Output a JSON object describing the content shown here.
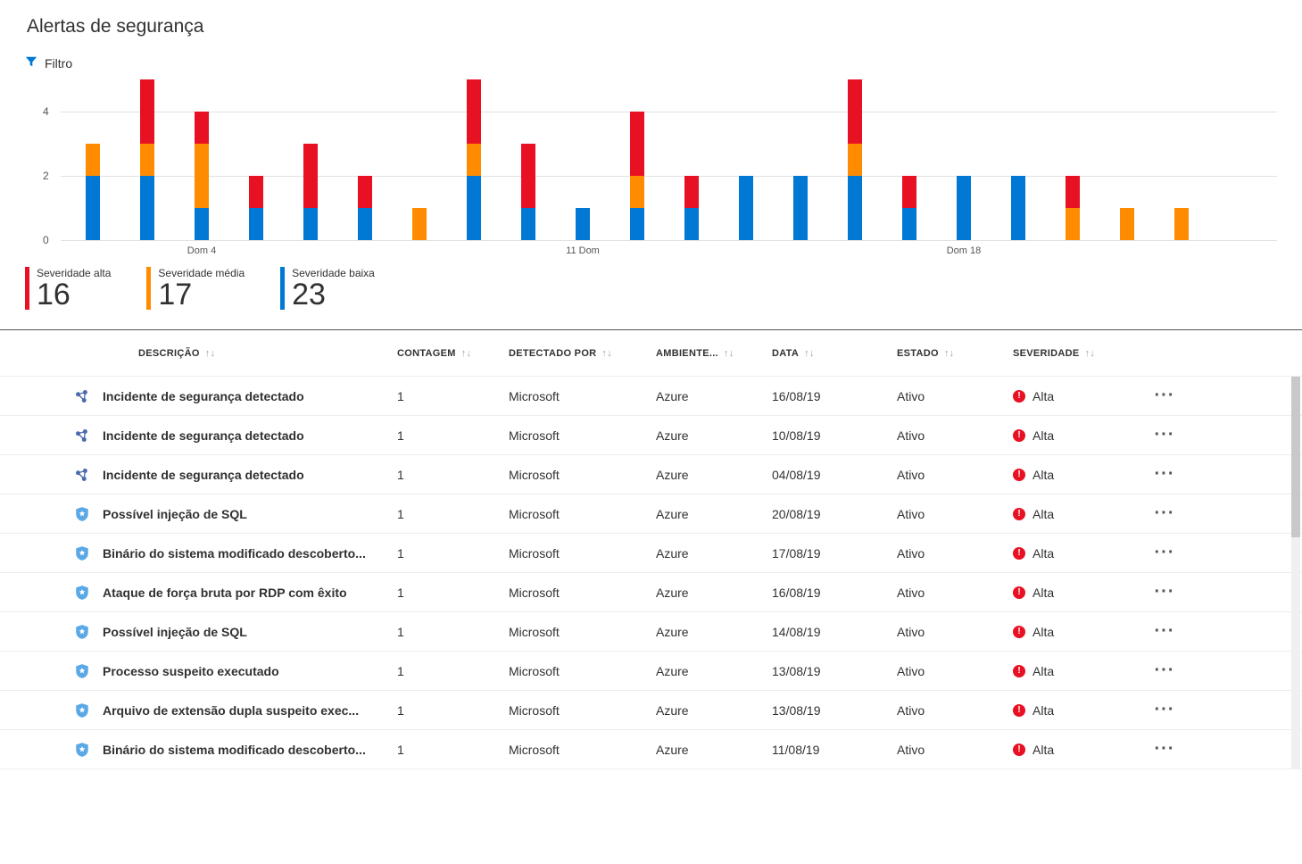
{
  "page_title": "Alertas de segurança",
  "filter_label": "Filtro",
  "chart_data": {
    "type": "bar",
    "stacked": true,
    "ylim": [
      0,
      5
    ],
    "yticks": [
      0,
      2,
      4
    ],
    "x_labels": [
      {
        "index": 2,
        "text": "Dom 4"
      },
      {
        "index": 9,
        "text": "11 Dom"
      },
      {
        "index": 16,
        "text": "Dom 18"
      }
    ],
    "series_names": [
      "Severidade baixa",
      "Severidade média",
      "Severidade alta"
    ],
    "categories": [
      "d1",
      "d2",
      "d3",
      "d4",
      "d5",
      "d6",
      "d7",
      "d8",
      "d9",
      "d10",
      "d11",
      "d12",
      "d13",
      "d14",
      "d15",
      "d16",
      "d17",
      "d18",
      "d19",
      "d20",
      "d21"
    ],
    "series": [
      {
        "name": "low",
        "color": "#0078d4",
        "values": [
          2,
          2,
          1,
          1,
          1,
          1,
          0,
          2,
          1,
          1,
          1,
          1,
          2,
          2,
          2,
          1,
          2,
          2,
          0,
          0,
          0
        ]
      },
      {
        "name": "med",
        "color": "#ff8c00",
        "values": [
          1,
          1,
          2,
          0,
          0,
          0,
          1,
          1,
          0,
          0,
          1,
          0,
          0,
          0,
          1,
          0,
          0,
          0,
          1,
          1,
          1
        ]
      },
      {
        "name": "high",
        "color": "#e81123",
        "values": [
          0,
          2,
          1,
          1,
          2,
          1,
          0,
          2,
          2,
          0,
          2,
          1,
          0,
          0,
          2,
          1,
          0,
          0,
          1,
          0,
          0
        ]
      }
    ]
  },
  "totals": [
    {
      "label": "Severidade alta",
      "value": "16",
      "color_class": "tbar-high"
    },
    {
      "label": "Severidade média",
      "value": "17",
      "color_class": "tbar-med"
    },
    {
      "label": "Severidade baixa",
      "value": "23",
      "color_class": "tbar-low"
    }
  ],
  "table": {
    "headers": {
      "descricao": "DESCRIÇÃO",
      "contagem": "CONTAGEM",
      "detectado": "DETECTADO POR",
      "ambiente": "AMBIENTE...",
      "data": "DATA",
      "estado": "ESTADO",
      "severidade": "SEVERIDADE"
    },
    "rows": [
      {
        "icon": "incident",
        "desc": "Incidente de segurança detectado",
        "count": "1",
        "detected": "Microsoft",
        "env": "Azure",
        "date": "16/08/19",
        "state": "Ativo",
        "sev": "Alta"
      },
      {
        "icon": "incident",
        "desc": "Incidente de segurança detectado",
        "count": "1",
        "detected": "Microsoft",
        "env": "Azure",
        "date": "10/08/19",
        "state": "Ativo",
        "sev": "Alta"
      },
      {
        "icon": "incident",
        "desc": "Incidente de segurança detectado",
        "count": "1",
        "detected": "Microsoft",
        "env": "Azure",
        "date": "04/08/19",
        "state": "Ativo",
        "sev": "Alta"
      },
      {
        "icon": "shield",
        "desc": "Possível injeção de SQL",
        "count": "1",
        "detected": "Microsoft",
        "env": "Azure",
        "date": "20/08/19",
        "state": "Ativo",
        "sev": "Alta"
      },
      {
        "icon": "shield",
        "desc": "Binário do sistema modificado descoberto...",
        "count": "1",
        "detected": "Microsoft",
        "env": "Azure",
        "date": "17/08/19",
        "state": "Ativo",
        "sev": "Alta"
      },
      {
        "icon": "shield",
        "desc": "Ataque de força bruta por RDP com êxito",
        "count": "1",
        "detected": "Microsoft",
        "env": "Azure",
        "date": "16/08/19",
        "state": "Ativo",
        "sev": "Alta"
      },
      {
        "icon": "shield",
        "desc": "Possível injeção de SQL",
        "count": "1",
        "detected": "Microsoft",
        "env": "Azure",
        "date": "14/08/19",
        "state": "Ativo",
        "sev": "Alta"
      },
      {
        "icon": "shield",
        "desc": "Processo suspeito executado",
        "count": "1",
        "detected": "Microsoft",
        "env": "Azure",
        "date": "13/08/19",
        "state": "Ativo",
        "sev": "Alta"
      },
      {
        "icon": "shield",
        "desc": "Arquivo de extensão dupla suspeito exec...",
        "count": "1",
        "detected": "Microsoft",
        "env": "Azure",
        "date": "13/08/19",
        "state": "Ativo",
        "sev": "Alta"
      },
      {
        "icon": "shield",
        "desc": "Binário do sistema modificado descoberto...",
        "count": "1",
        "detected": "Microsoft",
        "env": "Azure",
        "date": "11/08/19",
        "state": "Ativo",
        "sev": "Alta"
      }
    ]
  }
}
